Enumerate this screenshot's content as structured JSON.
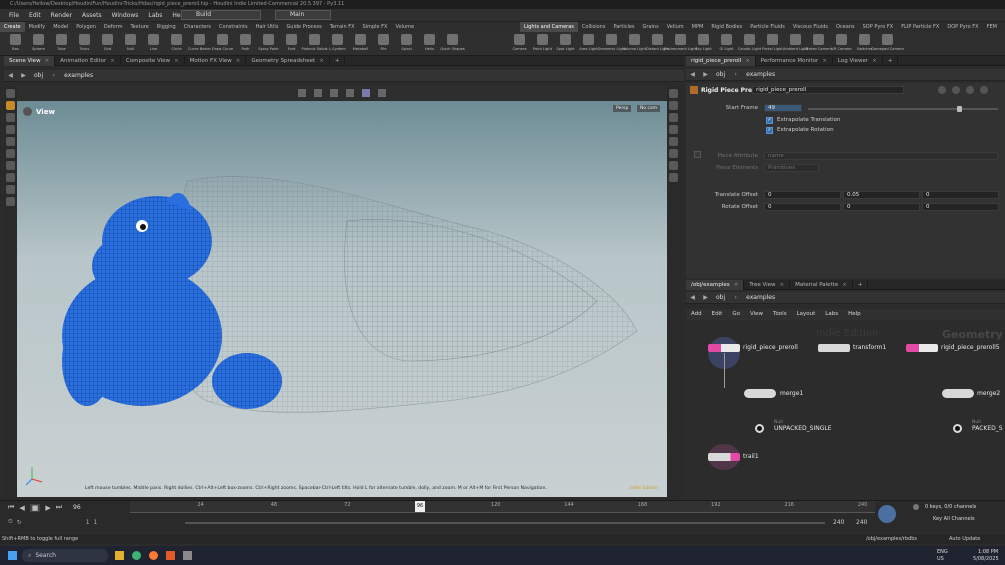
{
  "window": {
    "title": "C:/Users/Hellow/Desktop/HoudiniFun/Houdini-Tricks/Hdas/rigid_piece_preroll.hip - Houdini Indie Limited-Commercial 20.5.397 - Py3.11"
  },
  "menubar": {
    "items": [
      "File",
      "Edit",
      "Render",
      "Assets",
      "Windows",
      "Labs",
      "Help"
    ],
    "desktop": "Build",
    "context": "Main"
  },
  "shelf_tabs_left": [
    "Create",
    "Modify",
    "Model",
    "Polygon",
    "Deform",
    "Texture",
    "Rigging",
    "Characters",
    "Constraints",
    "Hair Utils",
    "Guide Process",
    "Terrain FX",
    "Simple FX",
    "Volume"
  ],
  "shelf_tabs_right": [
    "Lights and Cameras",
    "Collisions",
    "Particles",
    "Grains",
    "Vellum",
    "MPM",
    "Rigid Bodies",
    "Particle Fluids",
    "Viscous Fluids",
    "Oceans",
    "SOP Pyro FX",
    "FLIP Particle FX",
    "DOP Pyro FX",
    "FEM"
  ],
  "shelf_tools_left": [
    "Box",
    "Sphere",
    "Tube",
    "Torus",
    "Grid",
    "Null",
    "Line",
    "Circle",
    "Curve Bezier",
    "Draw Curve",
    "Path",
    "Spray Paint",
    "Font",
    "Platonic Solids",
    "L-System",
    "Metaball",
    "File",
    "Spiral",
    "Helix",
    "Quick Shapes"
  ],
  "shelf_tools_right": [
    "Camera",
    "Point Light",
    "Spot Light",
    "Area Light",
    "Geometry Light",
    "Volume Light",
    "Distant Light",
    "Environment Light",
    "Sky Light",
    "GI Light",
    "Caustic Light",
    "Portal Light",
    "Ambient Light",
    "Stereo Camera",
    "VR Camera",
    "Switcher",
    "Gamepad Camera"
  ],
  "left_tabs": [
    {
      "label": "Scene View",
      "active": true
    },
    {
      "label": "Animation Editor"
    },
    {
      "label": "Composite View"
    },
    {
      "label": "Motion FX View"
    },
    {
      "label": "Geometry Spreadsheet"
    }
  ],
  "left_path": {
    "root": "obj",
    "node": "examples"
  },
  "viewport": {
    "label": "View",
    "persp": "Persp",
    "cam": "No cam",
    "hint": "Left mouse tumbles. Middle pans. Right dollies. Ctrl+Alt+Left box-zooms. Ctrl+Right zooms. Spacebar-Ctrl-Left tilts. Hold L for alternate tumble, dolly, and zoom. M or Alt+M for First Person Navigation.",
    "badge": "Indie Edition"
  },
  "right_top_tabs": [
    {
      "label": "rigid_piece_preroll",
      "active": true
    },
    {
      "label": "Performance Monitor"
    },
    {
      "label": "Log Viewer"
    }
  ],
  "right_top_path": {
    "root": "obj",
    "node": "examples"
  },
  "params": {
    "node_type": "Rigid Piece Preroll",
    "node_name": "rigid_piece_preroll",
    "start_frame_label": "Start Frame",
    "start_frame": "49",
    "start_frame_fraction": 0.49,
    "extrapolate_translation": "Extrapolate Translation",
    "extrapolate_rotation": "Extrapolate Rotation",
    "piece_attribute_label": "Piece Attribute",
    "piece_attribute": "name",
    "piece_elements_label": "Piece Elements",
    "piece_elements": "Primitives",
    "translate_offset_label": "Translate Offset",
    "translate_offset": [
      "0",
      "0.05",
      "0"
    ],
    "rotate_offset_label": "Rotate Offset",
    "rotate_offset": [
      "0",
      "0",
      "0"
    ]
  },
  "net_tabs": [
    {
      "label": "/obj/examples",
      "active": true
    },
    {
      "label": "Tree View"
    },
    {
      "label": "Material Palette"
    }
  ],
  "net_path": {
    "root": "obj",
    "node": "examples"
  },
  "net_menu": [
    "Add",
    "Edit",
    "Go",
    "View",
    "Tools",
    "Layout",
    "Labs",
    "Help"
  ],
  "net_watermark": {
    "indie": "Indie Edition",
    "geometry": "Geometry"
  },
  "nodes": {
    "rigid1": "rigid_piece_preroll",
    "transform": "transform1",
    "rigid5": "rigid_piece_preroll5",
    "merge1": "merge1",
    "merge2": "merge2",
    "null_type": "Null",
    "null1": "UNPACKED_SINGLE",
    "null2": "PACKED_S",
    "trail": "trail1"
  },
  "timeline": {
    "ticks": [
      "24",
      "48",
      "72",
      "96",
      "120",
      "144",
      "168",
      "192",
      "216",
      "240"
    ],
    "current": "96",
    "current_fraction": 0.395,
    "frame": "96",
    "start": "1",
    "start2": "1",
    "end": "240",
    "end2": "240",
    "keys": "0 keys, 0/0 channels",
    "key_all": "Key All Channels",
    "auto_update": "Auto Update"
  },
  "status": {
    "hint": "Shift+RMB to toggle full range",
    "path": "/obj/examples/rbdbs"
  },
  "taskbar": {
    "search": "Search",
    "lang": "ENG",
    "region": "US",
    "time": "1:08 PM",
    "date": "5/08/2025"
  },
  "colors": {
    "accent": "#3a6fb0",
    "node_pink": "#e24aa6",
    "viewport_top": "#6d8c95",
    "model_blue": "#2a6fe0"
  }
}
